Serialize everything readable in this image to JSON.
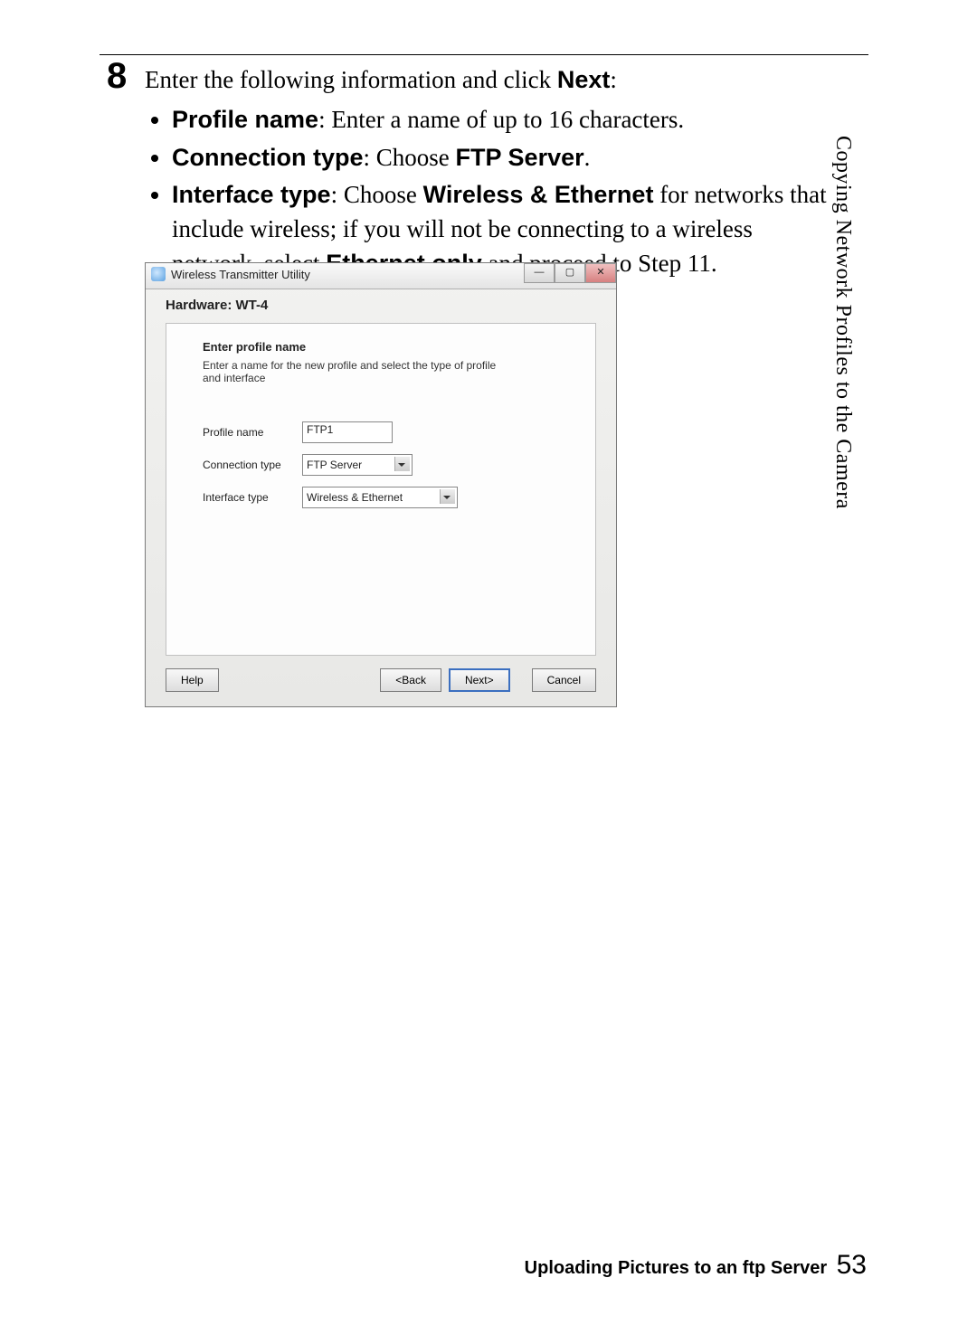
{
  "step_number": "8",
  "intro": {
    "line1_pre": "Enter the following information and click ",
    "line1_bold": "Next",
    "line1_post": ":"
  },
  "bullets": {
    "b1_label": "Profile name",
    "b1_text": ": Enter a name of up to 16 characters.",
    "b2_label": "Connection type",
    "b2_mid": ": Choose ",
    "b2_bold": "FTP Server",
    "b2_post": ".",
    "b3_label": "Interface type",
    "b3_mid": ": Choose ",
    "b3_bold1": "Wireless & Ethernet",
    "b3_text1": " for networks that include wireless; if you will not be connecting to a wireless network, select ",
    "b3_bold2": "Ethernet only",
    "b3_text2": " and proceed to Step 11."
  },
  "side_tab": "Copying Network Profiles to the Camera",
  "dialog": {
    "title": "Wireless Transmitter Utility",
    "hardware": "Hardware: WT-4",
    "heading": "Enter profile name",
    "subtext": "Enter a name for the new profile and select the type of profile and interface",
    "labels": {
      "profile_name": "Profile name",
      "connection_type": "Connection type",
      "interface_type": "Interface type"
    },
    "values": {
      "profile_name": "FTP1",
      "connection_type": "FTP Server",
      "interface_type": "Wireless & Ethernet"
    },
    "buttons": {
      "help": "Help",
      "back": "<Back",
      "next": "Next>",
      "cancel": "Cancel"
    },
    "win": {
      "min": "—",
      "max": "▢",
      "close": "✕"
    }
  },
  "footer": {
    "title": "Uploading Pictures to an ftp Server",
    "page": "53"
  }
}
